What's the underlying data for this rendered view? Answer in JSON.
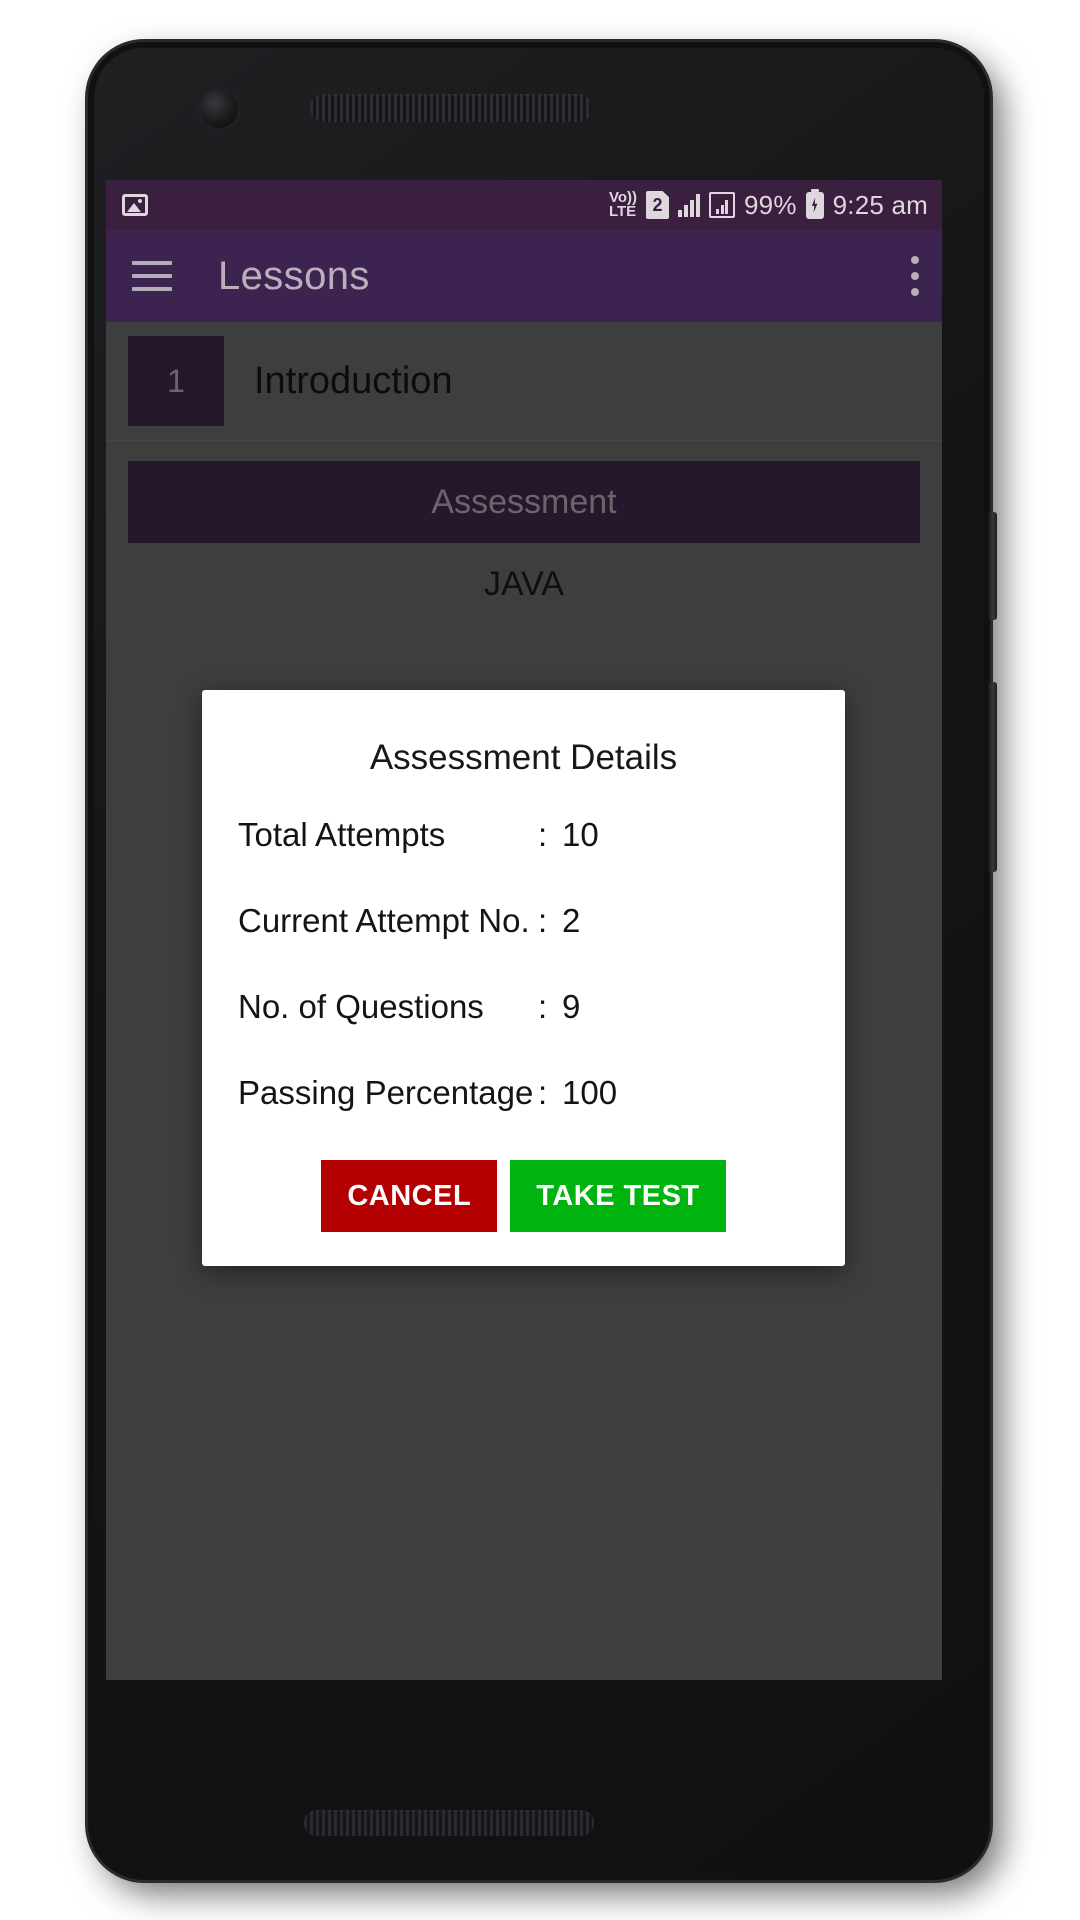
{
  "status_bar": {
    "notification_icon": "image-icon",
    "network_type": "VoLTE",
    "network_line1": "Vo))",
    "network_line2": "LTE",
    "sim_badge": "2",
    "signal_icon": "signal-bars-icon",
    "data_icon": "data-signal-icon",
    "battery_percent": "99%",
    "battery_icon": "battery-charging-icon",
    "time": "9:25 am"
  },
  "app_bar": {
    "menu_icon": "hamburger-menu-icon",
    "title": "Lessons",
    "overflow_icon": "more-vertical-icon"
  },
  "content": {
    "lesson": {
      "number": "1",
      "title": "Introduction"
    },
    "assessment_button": "Assessment",
    "subject": "JAVA"
  },
  "dialog": {
    "title": "Assessment Details",
    "rows": [
      {
        "label": "Total Attempts",
        "sep": ":",
        "value": "10"
      },
      {
        "label": "Current Attempt No.",
        "sep": ":",
        "value": "2"
      },
      {
        "label": "No. of Questions",
        "sep": ":",
        "value": "9"
      },
      {
        "label": "Passing Percentage",
        "sep": ":",
        "value": "100"
      }
    ],
    "cancel_label": "CANCEL",
    "take_test_label": "TAKE TEST"
  },
  "colors": {
    "status_bar_bg": "#3a1f3e",
    "app_bar_bg": "#3d2450",
    "accent_purple": "#412a4e",
    "page_bg": "#6b6b6b",
    "cancel_red": "#b40000",
    "take_test_green": "#00b410",
    "dialog_bg": "#ffffff"
  }
}
